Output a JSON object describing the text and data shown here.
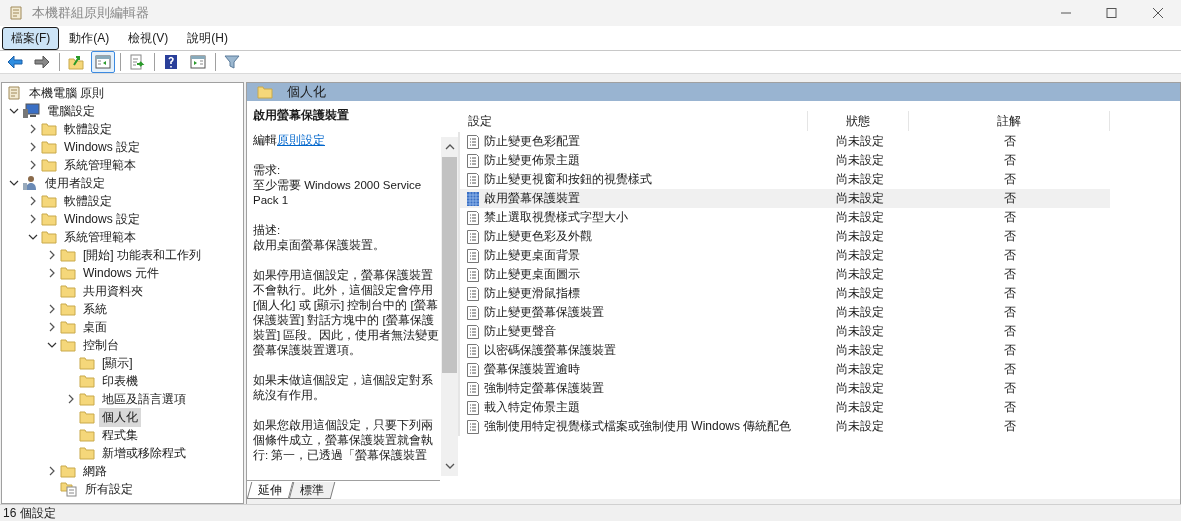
{
  "window": {
    "title": "本機群組原則編輯器"
  },
  "menu": [
    {
      "label": "檔案(F)",
      "selected": true
    },
    {
      "label": "動作(A)",
      "selected": false
    },
    {
      "label": "檢視(V)",
      "selected": false
    },
    {
      "label": "說明(H)",
      "selected": false
    }
  ],
  "toolbar": [
    [
      {
        "kind": "back",
        "pressed": false
      },
      {
        "kind": "forward",
        "pressed": false
      }
    ],
    [
      {
        "kind": "up",
        "pressed": false
      },
      {
        "kind": "pane",
        "pressed": true
      }
    ],
    [
      {
        "kind": "export",
        "pressed": false
      }
    ],
    [
      {
        "kind": "help",
        "pressed": false
      },
      {
        "kind": "actionpane",
        "pressed": false
      }
    ],
    [
      {
        "kind": "filter",
        "pressed": false
      }
    ]
  ],
  "tree": {
    "label": "本機電腦 原則",
    "kind": "policy",
    "selected": false,
    "children": [
      {
        "label": "電腦設定",
        "kind": "computer",
        "expanded": true,
        "selected": false,
        "children": [
          {
            "label": "軟體設定",
            "kind": "folder",
            "expanded": false,
            "selected": false
          },
          {
            "label": "Windows 設定",
            "kind": "folder",
            "expanded": false,
            "selected": false
          },
          {
            "label": "系統管理範本",
            "kind": "folder",
            "expanded": false,
            "selected": false
          }
        ]
      },
      {
        "label": "使用者設定",
        "kind": "user",
        "expanded": true,
        "selected": false,
        "children": [
          {
            "label": "軟體設定",
            "kind": "folder",
            "expanded": false,
            "selected": false
          },
          {
            "label": "Windows 設定",
            "kind": "folder",
            "expanded": false,
            "selected": false
          },
          {
            "label": "系統管理範本",
            "kind": "folder",
            "expanded": true,
            "selected": false,
            "children": [
              {
                "label": "[開始] 功能表和工作列",
                "kind": "folder",
                "expanded": false,
                "selected": false
              },
              {
                "label": "Windows 元件",
                "kind": "folder",
                "expanded": false,
                "selected": false
              },
              {
                "label": "共用資料夾",
                "kind": "folder",
                "selected": false
              },
              {
                "label": "系統",
                "kind": "folder",
                "expanded": false,
                "selected": false
              },
              {
                "label": "桌面",
                "kind": "folder",
                "expanded": false,
                "selected": false
              },
              {
                "label": "控制台",
                "kind": "folder",
                "expanded": true,
                "selected": false,
                "children": [
                  {
                    "label": "[顯示]",
                    "kind": "folder",
                    "selected": false
                  },
                  {
                    "label": "印表機",
                    "kind": "folder",
                    "selected": false
                  },
                  {
                    "label": "地區及語言選項",
                    "kind": "folder",
                    "expanded": false,
                    "selected": false
                  },
                  {
                    "label": "個人化",
                    "kind": "folder",
                    "selected": true
                  },
                  {
                    "label": "程式集",
                    "kind": "folder",
                    "selected": false
                  },
                  {
                    "label": "新增或移除程式",
                    "kind": "folder",
                    "selected": false
                  }
                ]
              },
              {
                "label": "網路",
                "kind": "folder",
                "expanded": false,
                "selected": false
              },
              {
                "label": "所有設定",
                "kind": "allsettings",
                "selected": false
              }
            ]
          }
        ]
      }
    ]
  },
  "panel": {
    "header": "個人化",
    "description": {
      "title": "啟用螢幕保護裝置",
      "edit_prefix": "編輯",
      "edit_link": "原則設定",
      "blocks": [
        [
          "需求:",
          "至少需要 Windows 2000 Service Pack 1"
        ],
        [
          "描述:",
          "啟用桌面螢幕保護裝置。"
        ],
        [
          "如果停用這個設定，螢幕保護裝置不會執行。此外，這個設定會停用 [個人化] 或 [顯示] 控制台中的 [螢幕保護裝置] 對話方塊中的 [螢幕保護裝置] 區段。因此，使用者無法變更螢幕保護裝置選項。"
        ],
        [
          "如果未做這個設定，這個設定對系統沒有作用。"
        ],
        [
          "如果您啟用這個設定，只要下列兩個條件成立，螢幕保護裝置就會執行: 第一，已透過「螢幕保護裝置"
        ]
      ]
    },
    "table": {
      "columns": [
        "設定",
        "狀態",
        "註解"
      ],
      "rows": [
        {
          "setting": "防止變更色彩配置",
          "state": "尚未設定",
          "comment": "否",
          "selected": false
        },
        {
          "setting": "防止變更佈景主題",
          "state": "尚未設定",
          "comment": "否",
          "selected": false
        },
        {
          "setting": "防止變更視窗和按鈕的視覺樣式",
          "state": "尚未設定",
          "comment": "否",
          "selected": false
        },
        {
          "setting": "啟用螢幕保護裝置",
          "state": "尚未設定",
          "comment": "否",
          "selected": true
        },
        {
          "setting": "禁止選取視覺樣式字型大小",
          "state": "尚未設定",
          "comment": "否",
          "selected": false
        },
        {
          "setting": "防止變更色彩及外觀",
          "state": "尚未設定",
          "comment": "否",
          "selected": false
        },
        {
          "setting": "防止變更桌面背景",
          "state": "尚未設定",
          "comment": "否",
          "selected": false
        },
        {
          "setting": "防止變更桌面圖示",
          "state": "尚未設定",
          "comment": "否",
          "selected": false
        },
        {
          "setting": "防止變更滑鼠指標",
          "state": "尚未設定",
          "comment": "否",
          "selected": false
        },
        {
          "setting": "防止變更螢幕保護裝置",
          "state": "尚未設定",
          "comment": "否",
          "selected": false
        },
        {
          "setting": "防止變更聲音",
          "state": "尚未設定",
          "comment": "否",
          "selected": false
        },
        {
          "setting": "以密碼保護螢幕保護裝置",
          "state": "尚未設定",
          "comment": "否",
          "selected": false
        },
        {
          "setting": "螢幕保護裝置逾時",
          "state": "尚未設定",
          "comment": "否",
          "selected": false
        },
        {
          "setting": "強制特定螢幕保護裝置",
          "state": "尚未設定",
          "comment": "否",
          "selected": false
        },
        {
          "setting": "載入特定佈景主題",
          "state": "尚未設定",
          "comment": "否",
          "selected": false
        },
        {
          "setting": "強制使用特定視覺樣式檔案或強制使用 Windows 傳統配色",
          "state": "尚未設定",
          "comment": "否",
          "selected": false
        }
      ]
    },
    "tabs": [
      {
        "label": "延伸",
        "selected": true
      },
      {
        "label": "標準",
        "selected": false
      }
    ]
  },
  "status_bar": {
    "text": "16 個設定"
  }
}
